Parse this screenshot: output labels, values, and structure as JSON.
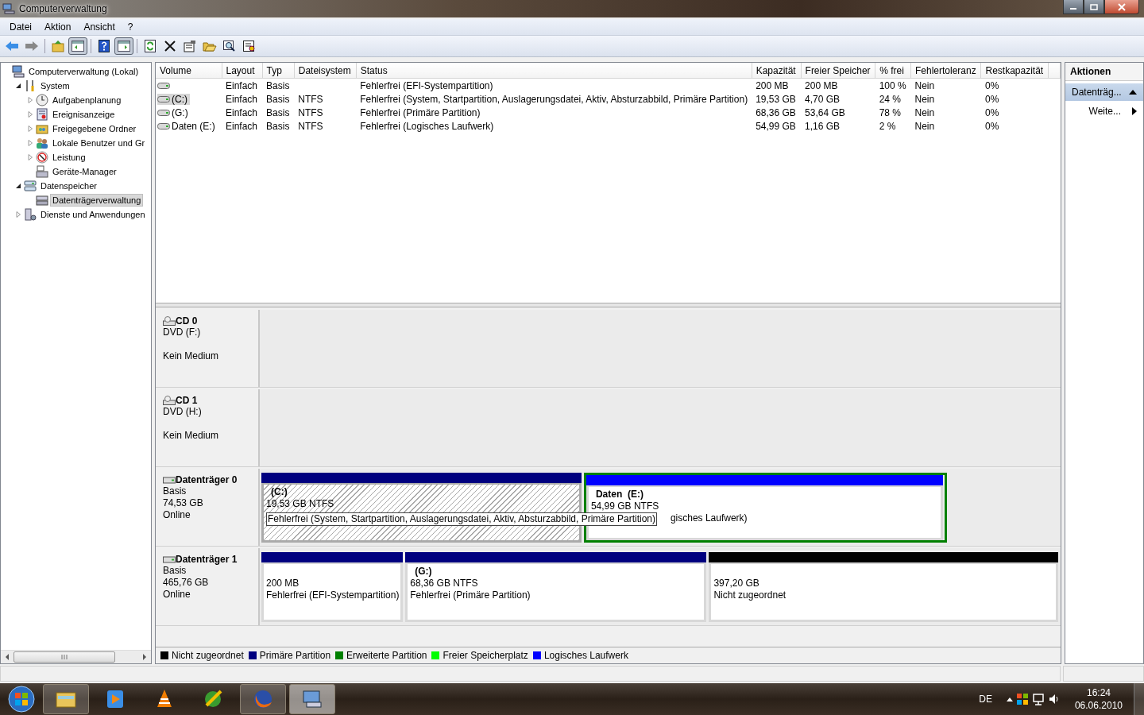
{
  "window": {
    "title": "Computerverwaltung"
  },
  "menu": [
    "Datei",
    "Aktion",
    "Ansicht",
    "?"
  ],
  "toolbar": [
    {
      "kind": "back",
      "pressed": false
    },
    {
      "kind": "forward",
      "pressed": false
    },
    {
      "kind": "up",
      "pressed": false
    },
    {
      "kind": "tree",
      "pressed": true
    },
    {
      "kind": "help",
      "pressed": false
    },
    {
      "kind": "actionpane",
      "pressed": true
    },
    {
      "kind": "refresh",
      "pressed": false
    },
    {
      "kind": "delete",
      "pressed": false
    },
    {
      "kind": "properties",
      "pressed": false
    },
    {
      "kind": "open",
      "pressed": false
    },
    {
      "kind": "search",
      "pressed": false
    },
    {
      "kind": "settings",
      "pressed": false
    }
  ],
  "tree": [
    {
      "label": "Computerverwaltung (Lokal)",
      "selected": false,
      "children": [
        {
          "label": "System",
          "expanded": true,
          "selected": false,
          "children": [
            {
              "label": "Aufgabenplanung",
              "expanded": false,
              "selected": false
            },
            {
              "label": "Ereignisanzeige",
              "expanded": false,
              "selected": false
            },
            {
              "label": "Freigegebene Ordner",
              "expanded": false,
              "selected": false
            },
            {
              "label": "Lokale Benutzer und Gr",
              "expanded": false,
              "selected": false
            },
            {
              "label": "Leistung",
              "expanded": false,
              "selected": false
            },
            {
              "label": "Geräte-Manager",
              "selected": false
            }
          ]
        },
        {
          "label": "Datenspeicher",
          "expanded": true,
          "selected": false,
          "children": [
            {
              "label": "Datenträgerverwaltung",
              "selected": true
            }
          ]
        },
        {
          "label": "Dienste und Anwendungen",
          "expanded": false,
          "selected": false
        }
      ]
    }
  ],
  "table": {
    "columns": [
      "Volume",
      "Layout",
      "Typ",
      "Dateisystem",
      "Status",
      "Kapazität",
      "Freier Speicher",
      "% frei",
      "Fehlertoleranz",
      "Restkapazität"
    ],
    "rows": [
      {
        "selected": false,
        "cells": [
          "",
          "Einfach",
          "Basis",
          "",
          "Fehlerfrei (EFI-Systempartition)",
          "200 MB",
          "200 MB",
          "100 %",
          "Nein",
          "0%"
        ]
      },
      {
        "selected": true,
        "cells": [
          "(C:)",
          "Einfach",
          "Basis",
          "NTFS",
          "Fehlerfrei (System, Startpartition, Auslagerungsdatei, Aktiv, Absturzabbild, Primäre Partition)",
          "19,53 GB",
          "4,70 GB",
          "24 %",
          "Nein",
          "0%"
        ]
      },
      {
        "selected": false,
        "cells": [
          "(G:)",
          "Einfach",
          "Basis",
          "NTFS",
          "Fehlerfrei (Primäre Partition)",
          "68,36 GB",
          "53,64 GB",
          "78 %",
          "Nein",
          "0%"
        ]
      },
      {
        "selected": false,
        "cells": [
          "Daten (E:)",
          "Einfach",
          "Basis",
          "NTFS",
          "Fehlerfrei (Logisches Laufwerk)",
          "54,99 GB",
          "1,16 GB",
          "2 %",
          "Nein",
          "0%"
        ]
      }
    ]
  },
  "disks": [
    {
      "kind": "cd",
      "name": "CD 0",
      "lines": [
        "DVD (F:)",
        "Kein Medium"
      ]
    },
    {
      "kind": "cd",
      "name": "CD 1",
      "lines": [
        "DVD (H:)",
        "Kein Medium"
      ]
    },
    {
      "kind": "disk",
      "name": "Datenträger 0",
      "lines": [
        "Basis",
        "74,53 GB",
        "Online"
      ],
      "partitions": [
        {
          "kind": "primary",
          "color": "#00007f",
          "selected": true,
          "title": "(C:)",
          "size": "19,53 GB NTFS",
          "status": "Fehlerfrei (System, Startpartition, Auslagerungsdatei, Aktiv, Absturzabbild, Primäre Partition)"
        },
        {
          "kind": "extended",
          "color": "#008000",
          "children": [
            {
              "kind": "logical",
              "color": "#0000ff",
              "selected": false,
              "title": "Daten  (E:)",
              "size": "54,99 GB NTFS",
              "status": "gisches Laufwerk)"
            }
          ]
        }
      ]
    },
    {
      "kind": "disk",
      "name": "Datenträger 1",
      "lines": [
        "Basis",
        "465,76 GB",
        "Online"
      ],
      "partitions": [
        {
          "kind": "primary",
          "color": "#00007f",
          "selected": false,
          "size": "200 MB",
          "status": "Fehlerfrei (EFI-Systempartition)"
        },
        {
          "kind": "primary",
          "color": "#00007f",
          "selected": false,
          "title": "(G:)",
          "size": "68,36 GB NTFS",
          "status": "Fehlerfrei (Primäre Partition)"
        },
        {
          "kind": "unallocated",
          "color": "#000000",
          "selected": false,
          "size": "397,20 GB",
          "status": "Nicht zugeordnet"
        }
      ]
    }
  ],
  "legend": [
    {
      "label": "Nicht zugeordnet",
      "color": "#000000"
    },
    {
      "label": "Primäre Partition",
      "color": "#00007f"
    },
    {
      "label": "Erweiterte Partition",
      "color": "#008000"
    },
    {
      "label": "Freier Speicherplatz",
      "color": "#00ff00"
    },
    {
      "label": "Logisches Laufwerk",
      "color": "#0000ff"
    }
  ],
  "actions": {
    "title": "Aktionen",
    "sections": [
      {
        "label": "Datenträg...",
        "expanded": true,
        "items": [
          "Weite..."
        ]
      }
    ]
  },
  "taskbar": {
    "buttons": [
      {
        "kind": "explorer",
        "running": true,
        "active": false
      },
      {
        "kind": "media",
        "running": false,
        "active": false
      },
      {
        "kind": "vlc",
        "running": false,
        "active": false
      },
      {
        "kind": "globe",
        "running": false,
        "active": false
      },
      {
        "kind": "firefox",
        "running": true,
        "active": false
      },
      {
        "kind": "mgmt",
        "running": true,
        "active": true
      }
    ],
    "language": "DE",
    "time": "16:24",
    "date": "06.06.2010"
  }
}
